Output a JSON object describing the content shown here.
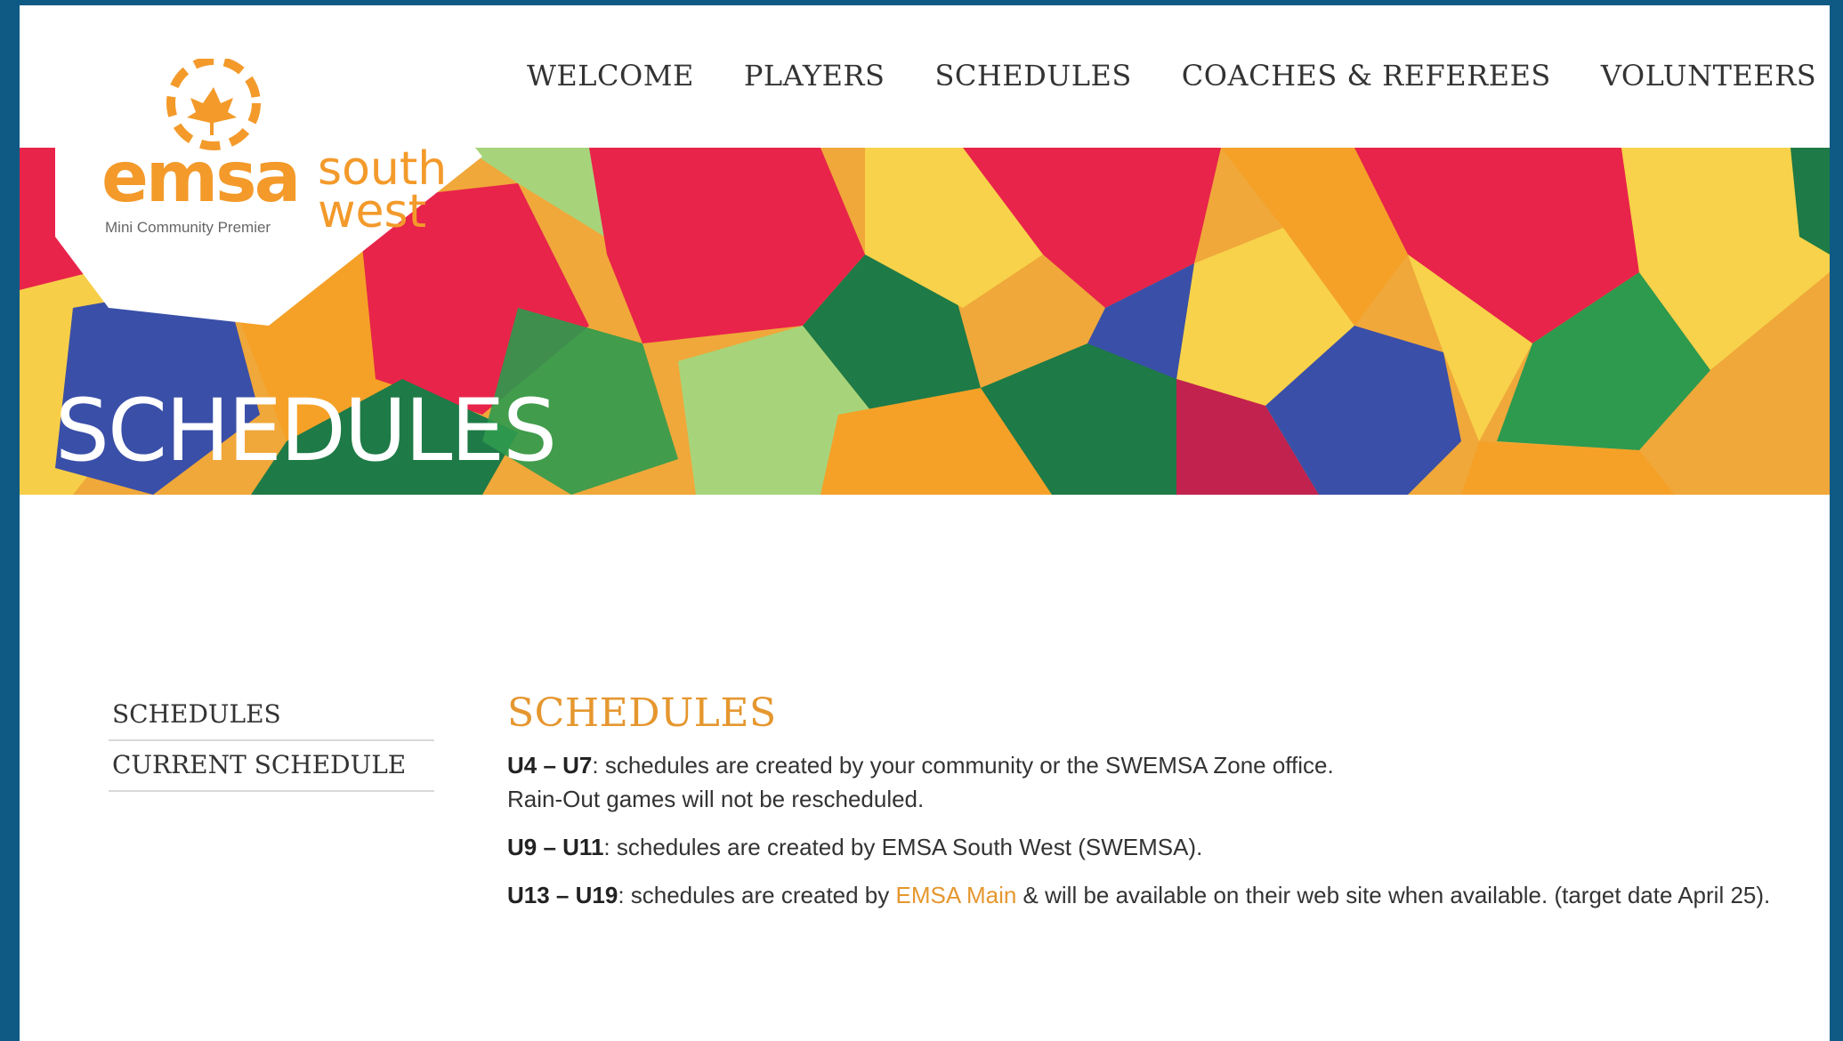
{
  "nav": {
    "items": [
      "WELCOME",
      "PLAYERS",
      "SCHEDULES",
      "COACHES & REFEREES",
      "VOLUNTEERS"
    ]
  },
  "logo": {
    "word": "emsa",
    "subtitle": "Mini Community Premier",
    "region": "south west"
  },
  "banner": {
    "title": "SCHEDULES"
  },
  "sidebar": {
    "items": [
      "SCHEDULES",
      "CURRENT SCHEDULE"
    ]
  },
  "main": {
    "title": "SCHEDULES",
    "p1_bold": "U4 – U7",
    "p1_text": ": schedules are created by your community or the SWEMSA Zone office.",
    "p1_line2": "Rain-Out games will not be rescheduled.",
    "p2_bold": "U9 – U11",
    "p2_text": ": schedules are created by EMSA South West (SWEMSA).",
    "p3_bold": "U13 – U19",
    "p3_text_a": ": schedules are created by ",
    "p3_link": "EMSA Main",
    "p3_text_b": " & will be available on their web site when available. (target date April 25)."
  },
  "colors": {
    "accent": "#e5972f",
    "frame": "#0e5a84",
    "banner": [
      "#e8244a",
      "#f5a128",
      "#1e7a46",
      "#3a4fa8",
      "#f7d24a",
      "#a7d47b"
    ]
  }
}
